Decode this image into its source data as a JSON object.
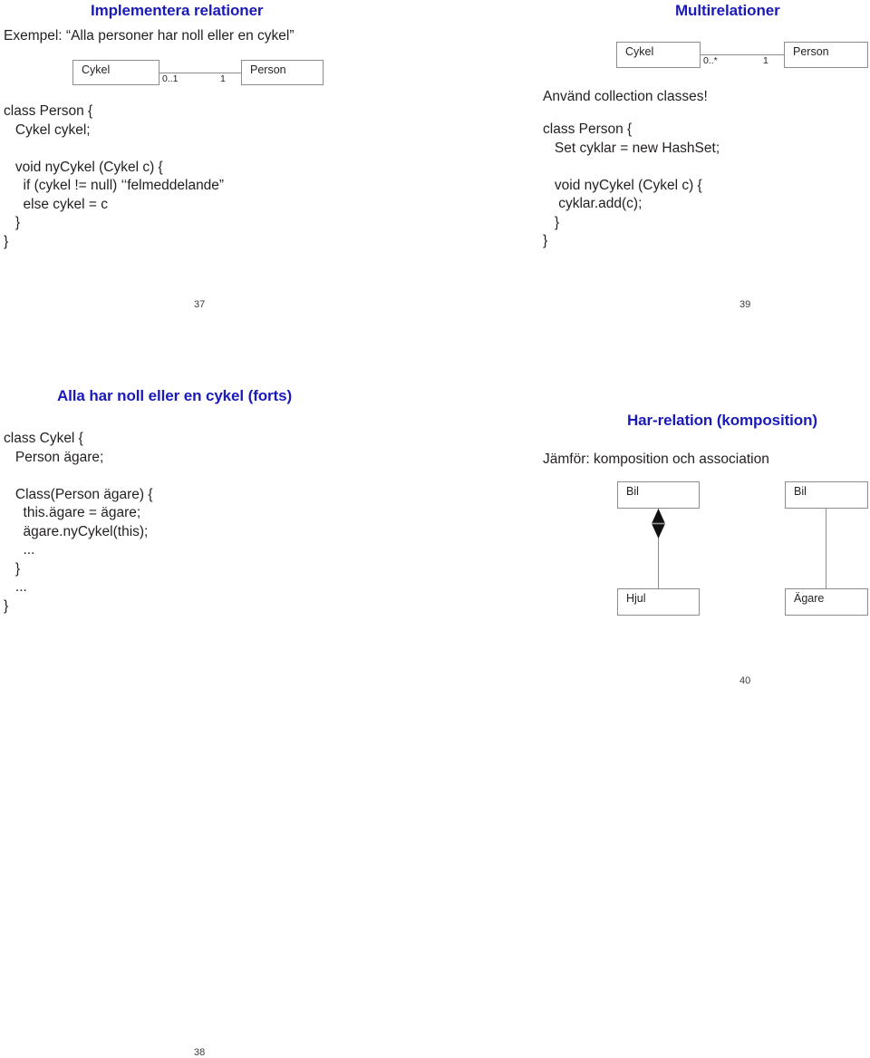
{
  "document": {
    "kind": "lecture-slide-handout",
    "slide_count": 4
  },
  "slides": [
    {
      "id": "slide-37",
      "page_number": "37",
      "title": "Implementera relationer",
      "subtitle": "Exempel: “Alla personer har noll eller en cykel”",
      "diagram": {
        "left_class": "Cykel",
        "right_class": "Person",
        "left_multiplicity": "0..1",
        "right_multiplicity": "1"
      },
      "code": "class Person {\n   Cykel cykel;\n\n   void nyCykel (Cykel c) {\n     if (cykel != null) ‘‘felmeddelande”\n     else cykel = c\n   }\n}"
    },
    {
      "id": "slide-39",
      "page_number": "39",
      "title": "Multirelationer",
      "subtitle": "Använd collection classes!",
      "diagram": {
        "left_class": "Cykel",
        "right_class": "Person",
        "left_multiplicity": "0..*",
        "right_multiplicity": "1"
      },
      "code": "class Person {\n   Set cyklar = new HashSet;\n\n   void nyCykel (Cykel c) {\n    cyklar.add(c);\n   }\n}"
    },
    {
      "id": "slide-38",
      "page_number": "38",
      "title": "Alla har noll eller en cykel (forts)",
      "code": "class Cykel {\n   Person ägare;\n\n   Class(Person ägare) {\n     this.ägare = ägare;\n     ägare.nyCykel(this);\n     ...\n   }\n   ...\n}"
    },
    {
      "id": "slide-40",
      "page_number": "40",
      "title": "Har-relation (komposition)",
      "subtitle": "Jämför: komposition och association",
      "diagram": {
        "composition": {
          "whole": "Bil",
          "part": "Hjul",
          "marker": "filled-diamond"
        },
        "association": {
          "from": "Bil",
          "to": "Ägare",
          "marker": "none"
        }
      }
    }
  ],
  "colors": {
    "title": "#1a1ab8",
    "body_text": "#231f20",
    "box_border": "#8c8c8c",
    "page_number": "#3c3c3c",
    "background": "#ffffff"
  }
}
